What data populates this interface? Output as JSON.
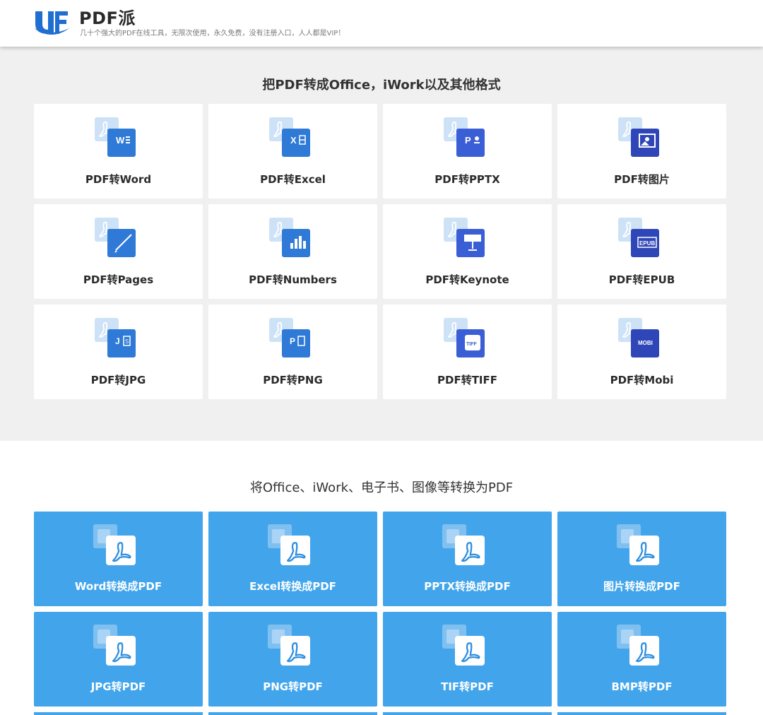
{
  "header": {
    "brand": "PDF派",
    "tagline": "几十个强大的PDF在线工具，无限次使用，永久免费，没有注册入口，人人都是VIP！"
  },
  "section1": {
    "heading": "把PDF转成Office，iWork以及其他格式",
    "cards": [
      {
        "label": "PDF转Word",
        "icon": "word-doc-icon",
        "color": "#2e7ad6"
      },
      {
        "label": "PDF转Excel",
        "icon": "excel-doc-icon",
        "color": "#2e7ad6"
      },
      {
        "label": "PDF转PPTX",
        "icon": "pptx-doc-icon",
        "color": "#3a5ed6"
      },
      {
        "label": "PDF转图片",
        "icon": "image-doc-icon",
        "color": "#2f46b8"
      },
      {
        "label": "PDF转Pages",
        "icon": "pages-pen-icon",
        "color": "#2e7ad6"
      },
      {
        "label": "PDF转Numbers",
        "icon": "numbers-chart-icon",
        "color": "#2e7ad6"
      },
      {
        "label": "PDF转Keynote",
        "icon": "keynote-podium-icon",
        "color": "#3a5ed6"
      },
      {
        "label": "PDF转EPUB",
        "icon": "epub-book-icon",
        "color": "#2f46b8"
      },
      {
        "label": "PDF转JPG",
        "icon": "jpg-doc-icon",
        "color": "#2e7ad6"
      },
      {
        "label": "PDF转PNG",
        "icon": "png-doc-icon",
        "color": "#2e7ad6"
      },
      {
        "label": "PDF转TIFF",
        "icon": "tiff-doc-icon",
        "color": "#3a5ed6"
      },
      {
        "label": "PDF转Mobi",
        "icon": "mobi-book-icon",
        "color": "#2f46b8"
      }
    ]
  },
  "section2": {
    "heading": "将Office、iWork、电子书、图像等转换为PDF",
    "cards": [
      {
        "label": "Word转换成PDF",
        "icon": "word-to-pdf-icon"
      },
      {
        "label": "Excel转换成PDF",
        "icon": "excel-to-pdf-icon"
      },
      {
        "label": "PPTX转换成PDF",
        "icon": "pptx-to-pdf-icon"
      },
      {
        "label": "图片转换成PDF",
        "icon": "image-to-pdf-icon"
      },
      {
        "label": "JPG转PDF",
        "icon": "jpg-to-pdf-icon"
      },
      {
        "label": "PNG转PDF",
        "icon": "png-to-pdf-icon"
      },
      {
        "label": "TIF转PDF",
        "icon": "tif-to-pdf-icon"
      },
      {
        "label": "BMP转PDF",
        "icon": "bmp-to-pdf-icon"
      }
    ]
  },
  "colors": {
    "accent_blue": "#42a5ec",
    "section_gray": "#f0f0f0",
    "pdf_red_logo": "#1f6fd1"
  }
}
